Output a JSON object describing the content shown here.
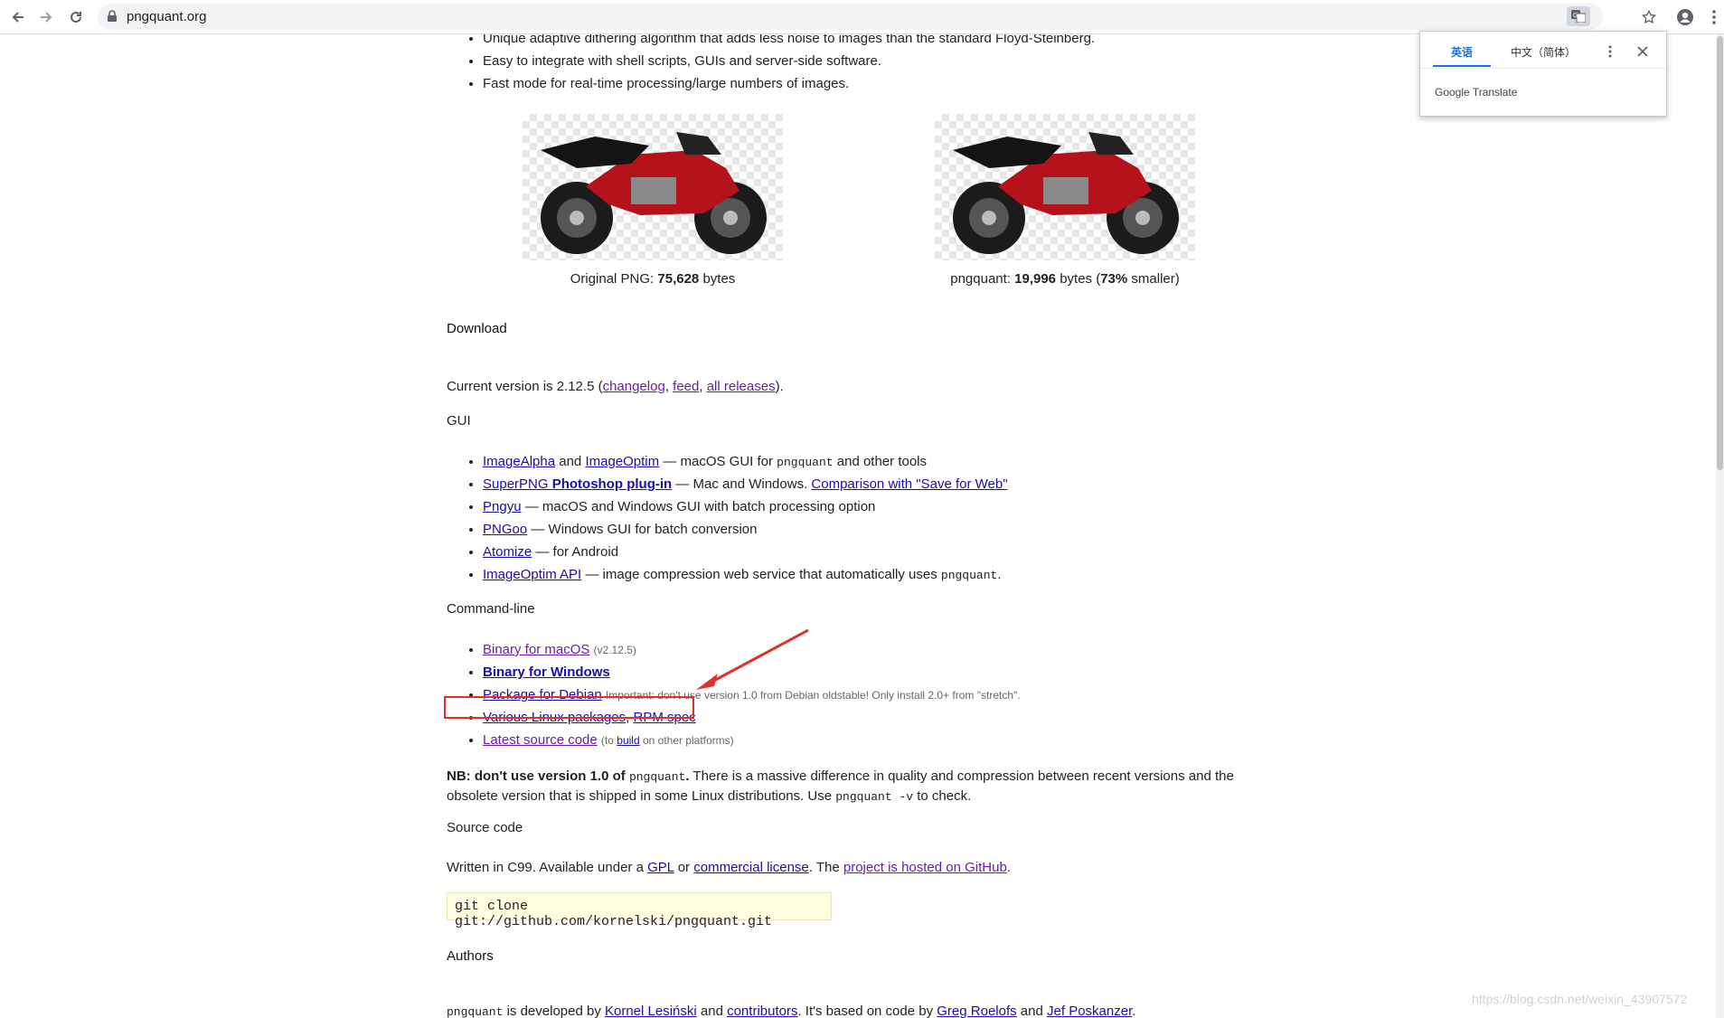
{
  "browser": {
    "url": "pngquant.org",
    "icons": [
      "back-icon",
      "forward-icon",
      "reload-icon",
      "lock-icon",
      "translate-icon",
      "star-icon",
      "account-icon",
      "menu-icon"
    ]
  },
  "translate_popup": {
    "tab_source": "英语",
    "tab_target": "中文（简体）",
    "brand": "Google Translate"
  },
  "features": {
    "items": [
      "Unique adaptive dithering algorithm that adds less noise to images than the standard Floyd-Steinberg.",
      "Easy to integrate with shell scripts, GUIs and server-side software.",
      "Fast mode for real-time processing/large numbers of images."
    ]
  },
  "comparison": {
    "original": {
      "prefix": "Original PNG: ",
      "bytes": "75,628",
      "suffix": " bytes"
    },
    "pngquant": {
      "prefix": "pngquant: ",
      "bytes": "19,996",
      "mid": " bytes (",
      "pct": "73%",
      "suffix": " smaller)"
    }
  },
  "download": {
    "title": "Download",
    "current_version_prefix": "Current version is 2.12.5 (",
    "links": {
      "changelog": "changelog",
      "feed": "feed",
      "all_releases": "all releases"
    },
    "close_paren": ")."
  },
  "gui": {
    "title": "GUI",
    "items": [
      {
        "link1": "ImageAlpha",
        "mid": " and ",
        "link2": "ImageOptim",
        "text": " — macOS GUI for ",
        "code": "pngquant",
        "text2": " and other tools"
      },
      {
        "link1": "SuperPNG",
        "link1b": "Photoshop plug-in",
        "text": " — Mac and Windows. ",
        "link2": "Comparison with \"Save for Web\""
      },
      {
        "link1": "Pngyu",
        "text": " — macOS and Windows GUI with batch processing option"
      },
      {
        "link1": "PNGoo",
        "text": " — Windows GUI for batch conversion"
      },
      {
        "link1": "Atomize",
        "text": " — for Android"
      },
      {
        "link1": "ImageOptim API",
        "text": " — image compression web service that automatically uses ",
        "code": "pngquant",
        "text2": "."
      }
    ]
  },
  "commandline": {
    "title": "Command-line",
    "macos": {
      "link": "Binary for macOS",
      "note": "(v2.12.5)"
    },
    "windows": {
      "link": "Binary for Windows"
    },
    "debian": {
      "link": "Package for Debian",
      "note": "Important: don't use version 1.0 from Debian oldstable! Only install 2.0+ from \"stretch\"."
    },
    "linux": {
      "link1": "Various Linux packages",
      "sep": ", ",
      "link2": "RPM spec"
    },
    "source": {
      "link": "Latest source code",
      "note_prefix": "(to ",
      "note_link": "build",
      "note_suffix": " on other platforms)"
    }
  },
  "nb": {
    "bold": "NB: don't use version 1.0 of ",
    "code1": "pngquant",
    "bold_end": ".",
    "text1": " There is a massive difference in quality and compression between recent versions and the obsolete version that is shipped in some Linux distributions. Use ",
    "code2": "pngquant -v",
    "text2": " to check."
  },
  "source_code": {
    "title": "Source code",
    "prefix": "Written in C99. Available under a ",
    "gpl": "GPL",
    "or": " or ",
    "commercial": "commercial license",
    "mid": ". The ",
    "github": "project is hosted on GitHub",
    "end": ".",
    "git_command": "git clone git://github.com/kornelski/pngquant.git"
  },
  "authors": {
    "title": "Authors",
    "code": "pngquant",
    "text1": " is developed by ",
    "kornel": "Kornel Lesiński",
    "and1": " and ",
    "contributors": "contributors",
    "text2": ". It's based on code by ",
    "greg": "Greg Roelofs",
    "and2": " and ",
    "jef": "Jef Poskanzer",
    "end": "."
  },
  "watermark": "https://blog.csdn.net/weixin_43907572",
  "colors": {
    "link": "#1a0dab",
    "visited": "#681da8",
    "highlight": "#e0312d"
  }
}
